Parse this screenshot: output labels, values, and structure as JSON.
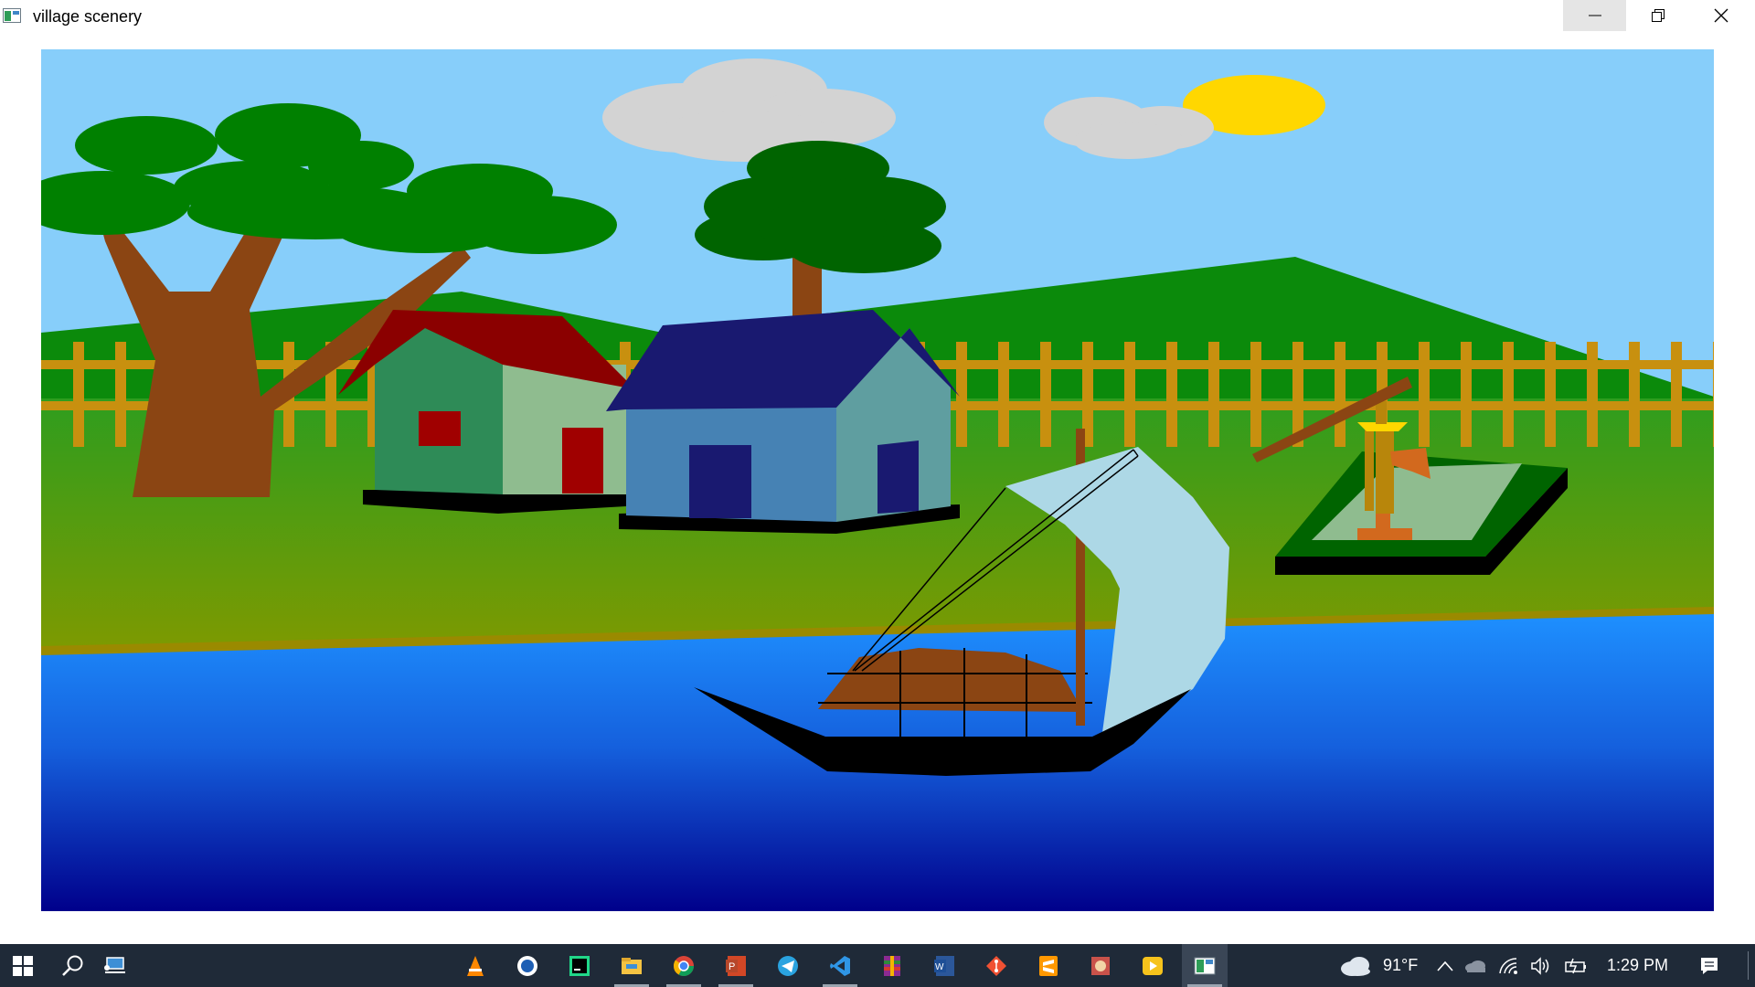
{
  "window": {
    "title": "village scenery",
    "buttons": {
      "minimize": "minimize",
      "maximize": "restore",
      "close": "close"
    }
  },
  "scene": {
    "colors": {
      "sky": "#87cefa",
      "cloud": "#d3d3d3",
      "sun": "#ffd700",
      "hill": "#0b8a0b",
      "fence": "#c8900f",
      "grass_top": "#2e9d1e",
      "grass_bottom": "#7f9a00",
      "water_top": "#1e90ff",
      "water_bottom": "#00008b",
      "tree_trunk": "#8b4513",
      "tree_leaves": "#008000",
      "tree_leaves_dark": "#006400",
      "house1_roof": "#8b0000",
      "house1_front": "#2e8b57",
      "house1_side": "#8fbc8f",
      "house1_door": "#a00000",
      "house2_roof": "#191970",
      "house2_front": "#4682b4",
      "house2_side": "#5f9ea0",
      "boat_hull": "#000000",
      "boat_cabin": "#8b4513",
      "sail": "#add8e6",
      "well_border": "#006400",
      "well_inner": "#8fbc8f",
      "pump": "#b8860b"
    }
  },
  "taskbar": {
    "apps": [
      {
        "name": "vlc-icon"
      },
      {
        "name": "browser-icon"
      },
      {
        "name": "pycharm-icon"
      },
      {
        "name": "file-explorer-icon"
      },
      {
        "name": "chrome-icon"
      },
      {
        "name": "powerpoint-icon"
      },
      {
        "name": "telegram-icon"
      },
      {
        "name": "vscode-icon"
      },
      {
        "name": "winrar-icon"
      },
      {
        "name": "word-icon"
      },
      {
        "name": "git-icon"
      },
      {
        "name": "sublime-icon"
      },
      {
        "name": "app-icon"
      },
      {
        "name": "media-player-icon"
      },
      {
        "name": "village-scenery-app-icon"
      }
    ],
    "weather": {
      "temperature": "91°F"
    },
    "clock": {
      "time": "1:29 PM"
    }
  }
}
